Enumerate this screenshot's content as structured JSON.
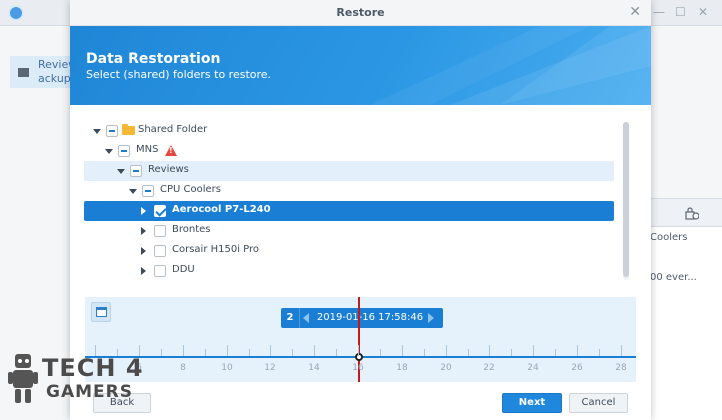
{
  "background_app": {
    "sidebar_item_label": "Review\nackup",
    "right_panel_line1": "Coolers",
    "right_panel_line2": "00 ever..."
  },
  "dialog": {
    "title": "Restore",
    "header": {
      "title": "Data Restoration",
      "subtitle": "Select (shared) folders to restore."
    },
    "tree": [
      {
        "label": "Shared Folder",
        "level": 0,
        "expanded": true,
        "check": "partial",
        "icon": "folder-icon"
      },
      {
        "label": "MNS",
        "level": 1,
        "expanded": true,
        "check": "partial",
        "icon": "warning-icon"
      },
      {
        "label": "Reviews",
        "level": 2,
        "expanded": true,
        "check": "partial",
        "highlight": true
      },
      {
        "label": "CPU Coolers",
        "level": 3,
        "expanded": true,
        "check": "partial"
      },
      {
        "label": "Aerocool P7-L240",
        "level": 4,
        "expanded": false,
        "check": "checked",
        "selected": true
      },
      {
        "label": "Brontes",
        "level": 4,
        "expanded": false,
        "check": "none"
      },
      {
        "label": "Corsair H150i Pro",
        "level": 4,
        "expanded": false,
        "check": "none"
      },
      {
        "label": "DDU",
        "level": 4,
        "expanded": false,
        "check": "none"
      }
    ],
    "timeline": {
      "version_count": "2",
      "selected_date": "2019-01-16 17:58:46",
      "tick_labels": [
        "6",
        "8",
        "10",
        "12",
        "14",
        "16",
        "18",
        "20",
        "22",
        "24",
        "26",
        "28"
      ],
      "selected_day": 16
    },
    "buttons": {
      "back": "Back",
      "next": "Next",
      "cancel": "Cancel"
    }
  },
  "watermark": {
    "line1": "TECH 4",
    "line2": "GAMERS"
  },
  "colors": {
    "accent": "#1a7fd4",
    "needle": "#c41a1a",
    "warning": "#e8473d",
    "folder": "#f5b935"
  }
}
